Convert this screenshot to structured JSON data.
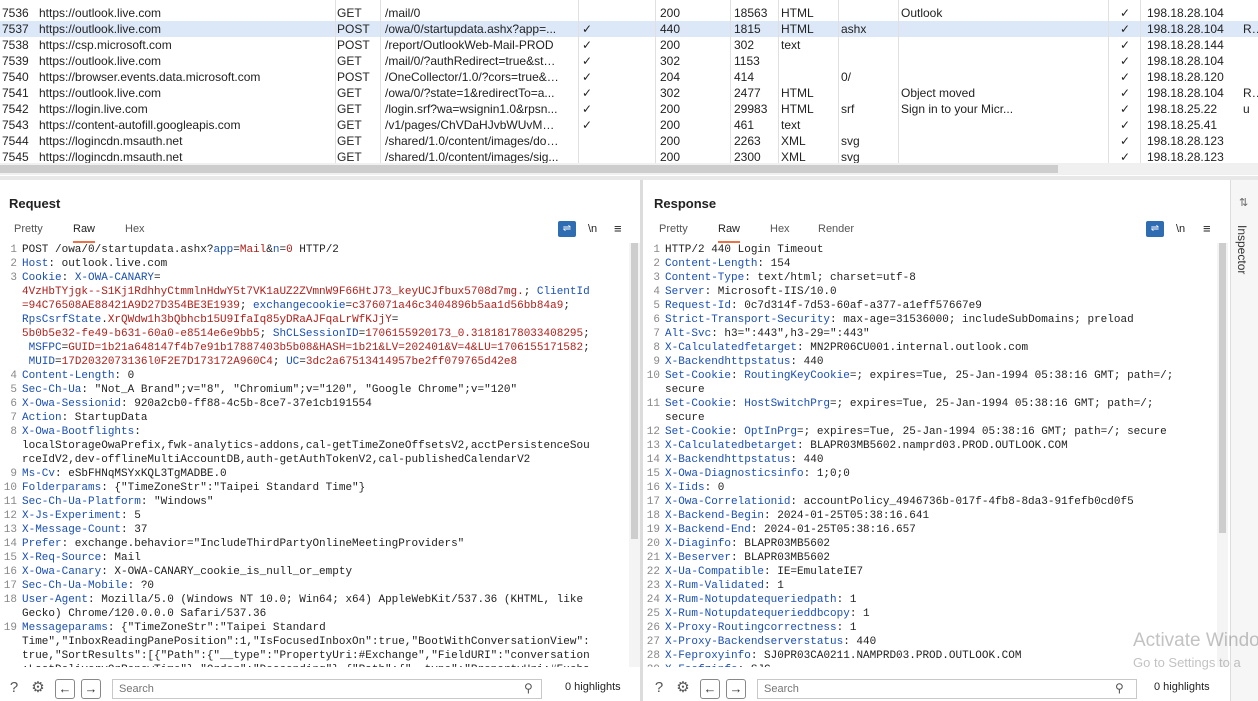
{
  "history": [
    {
      "id": "7536",
      "host": "https://outlook.live.com",
      "method": "GET",
      "url": "/mail/0",
      "params": "",
      "status": "200",
      "length": "18563",
      "mime": "HTML",
      "ext": "",
      "title": "Outlook",
      "tls": "✓",
      "ip": "198.18.28.104",
      "extra": ""
    },
    {
      "id": "7537",
      "host": "https://outlook.live.com",
      "method": "POST",
      "url": "/owa/0/startupdata.ashx?app=...",
      "params": "✓",
      "status": "440",
      "length": "1815",
      "mime": "HTML",
      "ext": "ashx",
      "title": "",
      "tls": "✓",
      "ip": "198.18.28.104",
      "extra": "Re",
      "selected": true
    },
    {
      "id": "7538",
      "host": "https://csp.microsoft.com",
      "method": "POST",
      "url": "/report/OutlookWeb-Mail-PROD",
      "params": "✓",
      "status": "200",
      "length": "302",
      "mime": "text",
      "ext": "",
      "title": "",
      "tls": "✓",
      "ip": "198.18.28.144",
      "extra": ""
    },
    {
      "id": "7539",
      "host": "https://outlook.live.com",
      "method": "GET",
      "url": "/mail/0/?authRedirect=true&sta...",
      "params": "✓",
      "status": "302",
      "length": "1153",
      "mime": "",
      "ext": "",
      "title": "",
      "tls": "✓",
      "ip": "198.18.28.104",
      "extra": ""
    },
    {
      "id": "7540",
      "host": "https://browser.events.data.microsoft.com",
      "method": "POST",
      "url": "/OneCollector/1.0/?cors=true&c...",
      "params": "✓",
      "status": "204",
      "length": "414",
      "mime": "",
      "ext": "0/",
      "title": "",
      "tls": "✓",
      "ip": "198.18.28.120",
      "extra": ""
    },
    {
      "id": "7541",
      "host": "https://outlook.live.com",
      "method": "GET",
      "url": "/owa/0/?state=1&redirectTo=a...",
      "params": "✓",
      "status": "302",
      "length": "2477",
      "mime": "HTML",
      "ext": "",
      "title": "Object moved",
      "tls": "✓",
      "ip": "198.18.28.104",
      "extra": "Re"
    },
    {
      "id": "7542",
      "host": "https://login.live.com",
      "method": "GET",
      "url": "/login.srf?wa=wsignin1.0&rpsn...",
      "params": "✓",
      "status": "200",
      "length": "29983",
      "mime": "HTML",
      "ext": "srf",
      "title": "Sign in to your Micr...",
      "tls": "✓",
      "ip": "198.18.25.22",
      "extra": "u"
    },
    {
      "id": "7543",
      "host": "https://content-autofill.googleapis.com",
      "method": "GET",
      "url": "/v1/pages/ChVDaHJvbWUvMTIw...",
      "params": "✓",
      "status": "200",
      "length": "461",
      "mime": "text",
      "ext": "",
      "title": "",
      "tls": "✓",
      "ip": "198.18.25.41",
      "extra": ""
    },
    {
      "id": "7544",
      "host": "https://logincdn.msauth.net",
      "method": "GET",
      "url": "/shared/1.0/content/images/doc...",
      "params": "",
      "status": "200",
      "length": "2263",
      "mime": "XML",
      "ext": "svg",
      "title": "",
      "tls": "✓",
      "ip": "198.18.28.123",
      "extra": ""
    },
    {
      "id": "7545",
      "host": "https://logincdn.msauth.net",
      "method": "GET",
      "url": "/shared/1.0/content/images/sig...",
      "params": "",
      "status": "200",
      "length": "2300",
      "mime": "XML",
      "ext": "svg",
      "title": "",
      "tls": "✓",
      "ip": "198.18.28.123",
      "extra": ""
    }
  ],
  "request": {
    "title": "Request",
    "tabs": [
      "Pretty",
      "Raw",
      "Hex"
    ],
    "active_tab": "Raw",
    "newline_label": "\\n",
    "lines": [
      {
        "n": "1",
        "parts": [
          [
            "v",
            "POST /owa/0/startupdata.ashx?"
          ],
          [
            "k",
            "app"
          ],
          [
            "v",
            "="
          ],
          [
            "r",
            "Mail"
          ],
          [
            "v",
            "&"
          ],
          [
            "k",
            "n"
          ],
          [
            "v",
            "="
          ],
          [
            "r",
            "0"
          ],
          [
            "v",
            " HTTP/2"
          ]
        ]
      },
      {
        "n": "2",
        "parts": [
          [
            "k",
            "Host"
          ],
          [
            "v",
            ": outlook.live.com"
          ]
        ]
      },
      {
        "n": "3",
        "parts": [
          [
            "k",
            "Cookie"
          ],
          [
            "v",
            ": "
          ],
          [
            "k",
            "X-OWA-CANARY"
          ],
          [
            "v",
            "="
          ]
        ]
      },
      {
        "n": "",
        "parts": [
          [
            "r",
            "4VzHbTYjgk--S1Kj1RdhhyCtmmlnHdwY5t7VK1aUZ2ZVmnW9F66HtJ73_keyUCJfbux5708d7mg."
          ],
          [
            "v",
            "; "
          ],
          [
            "k",
            "ClientId"
          ]
        ]
      },
      {
        "n": "",
        "parts": [
          [
            "r",
            "=94C76508AE88421A9D27D354BE3E1939"
          ],
          [
            "v",
            "; "
          ],
          [
            "k",
            "exchangecookie"
          ],
          [
            "v",
            "="
          ],
          [
            "r",
            "c376071a46c3404896b5aa1d56bb84a9"
          ],
          [
            "v",
            ";"
          ]
        ]
      },
      {
        "n": "",
        "parts": [
          [
            "k",
            "RpsCsrfState"
          ],
          [
            "v",
            "."
          ],
          [
            "r",
            "XrQWdw1h3bQbhcb15U9IfaIq85yDRaAJFqaLrWfKJjY"
          ],
          [
            "v",
            "="
          ]
        ]
      },
      {
        "n": "",
        "parts": [
          [
            "r",
            "5b0b5e32-fe49-b631-60a0-e8514e6e9bb5"
          ],
          [
            "v",
            "; "
          ],
          [
            "k",
            "ShCLSessionID"
          ],
          [
            "v",
            "="
          ],
          [
            "r",
            "1706155920173_0.31818178033408295"
          ],
          [
            "v",
            ";"
          ]
        ]
      },
      {
        "n": "",
        "parts": [
          [
            "k",
            " MSFPC"
          ],
          [
            "v",
            "="
          ],
          [
            "r",
            "GUID=1b21a648147f4b7e91b17887403b5b08&HASH=1b21&LV=202401&V=4&LU=1706155171582"
          ],
          [
            "v",
            ";"
          ]
        ]
      },
      {
        "n": "",
        "parts": [
          [
            "k",
            " MUID"
          ],
          [
            "v",
            "="
          ],
          [
            "r",
            "17D2032073136l0F2E7D173172A960C4"
          ],
          [
            "v",
            "; "
          ],
          [
            "k",
            "UC"
          ],
          [
            "v",
            "="
          ],
          [
            "r",
            "3dc2a67513414957be2ff079765d42e8"
          ]
        ]
      },
      {
        "n": "4",
        "parts": [
          [
            "k",
            "Content-Length"
          ],
          [
            "v",
            ": 0"
          ]
        ]
      },
      {
        "n": "5",
        "parts": [
          [
            "k",
            "Sec-Ch-Ua"
          ],
          [
            "v",
            ": \"Not_A Brand\";v=\"8\", \"Chromium\";v=\"120\", \"Google Chrome\";v=\"120\""
          ]
        ]
      },
      {
        "n": "6",
        "parts": [
          [
            "k",
            "X-Owa-Sessionid"
          ],
          [
            "v",
            ": 920a2cb0-ff88-4c5b-8ce7-37e1cb191554"
          ]
        ]
      },
      {
        "n": "7",
        "parts": [
          [
            "k",
            "Action"
          ],
          [
            "v",
            ": StartupData"
          ]
        ]
      },
      {
        "n": "8",
        "parts": [
          [
            "k",
            "X-Owa-Bootflights"
          ],
          [
            "v",
            ":"
          ]
        ]
      },
      {
        "n": "",
        "parts": [
          [
            "v",
            "localStorageOwaPrefix,fwk-analytics-addons,cal-getTimeZoneOffsetsV2,acctPersistenceSou"
          ]
        ]
      },
      {
        "n": "",
        "parts": [
          [
            "v",
            "rceIdV2,dev-offlineMultiAccountDB,auth-getAuthTokenV2,cal-publishedCalendarV2"
          ]
        ]
      },
      {
        "n": "9",
        "parts": [
          [
            "k",
            "Ms-Cv"
          ],
          [
            "v",
            ": eSbFHNqMSYxKQL3TgMADBE.0"
          ]
        ]
      },
      {
        "n": "10",
        "parts": [
          [
            "k",
            "Folderparams"
          ],
          [
            "v",
            ": {\"TimeZoneStr\":\"Taipei Standard Time\"}"
          ]
        ]
      },
      {
        "n": "11",
        "parts": [
          [
            "k",
            "Sec-Ch-Ua-Platform"
          ],
          [
            "v",
            ": \"Windows\""
          ]
        ]
      },
      {
        "n": "12",
        "parts": [
          [
            "k",
            "X-Js-Experiment"
          ],
          [
            "v",
            ": 5"
          ]
        ]
      },
      {
        "n": "13",
        "parts": [
          [
            "k",
            "X-Message-Count"
          ],
          [
            "v",
            ": 37"
          ]
        ]
      },
      {
        "n": "14",
        "parts": [
          [
            "k",
            "Prefer"
          ],
          [
            "v",
            ": exchange.behavior=\"IncludeThirdPartyOnlineMeetingProviders\""
          ]
        ]
      },
      {
        "n": "15",
        "parts": [
          [
            "k",
            "X-Req-Source"
          ],
          [
            "v",
            ": Mail"
          ]
        ]
      },
      {
        "n": "16",
        "parts": [
          [
            "k",
            "X-Owa-Canary"
          ],
          [
            "v",
            ": X-OWA-CANARY_cookie_is_null_or_empty"
          ]
        ]
      },
      {
        "n": "17",
        "parts": [
          [
            "k",
            "Sec-Ch-Ua-Mobile"
          ],
          [
            "v",
            ": ?0"
          ]
        ]
      },
      {
        "n": "18",
        "parts": [
          [
            "k",
            "User-Agent"
          ],
          [
            "v",
            ": Mozilla/5.0 (Windows NT 10.0; Win64; x64) AppleWebKit/537.36 (KHTML, like"
          ]
        ]
      },
      {
        "n": "",
        "parts": [
          [
            "v",
            "Gecko) Chrome/120.0.0.0 Safari/537.36"
          ]
        ]
      },
      {
        "n": "19",
        "parts": [
          [
            "k",
            "Messageparams"
          ],
          [
            "v",
            ": {\"TimeZoneStr\":\"Taipei Standard"
          ]
        ]
      },
      {
        "n": "",
        "parts": [
          [
            "v",
            "Time\",\"InboxReadingPanePosition\":1,\"IsFocusedInboxOn\":true,\"BootWithConversationView\":"
          ]
        ]
      },
      {
        "n": "",
        "parts": [
          [
            "v",
            "true,\"SortResults\":[{\"Path\":{\"__type\":\"PropertyUri:#Exchange\",\"FieldURI\":\"conversation"
          ]
        ]
      },
      {
        "n": "",
        "parts": [
          [
            "v",
            ":LastDeliveryOrRenewTime\"},\"Order\":\"Descending\"},{\"Path\":{\"__type\":\"PropertyUri:#Excha"
          ]
        ]
      }
    ],
    "search_placeholder": "Search",
    "highlights": "0 highlights"
  },
  "response": {
    "title": "Response",
    "tabs": [
      "Pretty",
      "Raw",
      "Hex",
      "Render"
    ],
    "active_tab": "Raw",
    "newline_label": "\\n",
    "lines": [
      {
        "n": "1",
        "parts": [
          [
            "v",
            "HTTP/2 440 Login Timeout"
          ]
        ]
      },
      {
        "n": "2",
        "parts": [
          [
            "k",
            "Content-Length"
          ],
          [
            "v",
            ": 154"
          ]
        ]
      },
      {
        "n": "3",
        "parts": [
          [
            "k",
            "Content-Type"
          ],
          [
            "v",
            ": text/html; charset=utf-8"
          ]
        ]
      },
      {
        "n": "4",
        "parts": [
          [
            "k",
            "Server"
          ],
          [
            "v",
            ": Microsoft-IIS/10.0"
          ]
        ]
      },
      {
        "n": "5",
        "parts": [
          [
            "k",
            "Request-Id"
          ],
          [
            "v",
            ": 0c7d314f-7d53-60af-a377-a1eff57667e9"
          ]
        ]
      },
      {
        "n": "6",
        "parts": [
          [
            "k",
            "Strict-Transport-Security"
          ],
          [
            "v",
            ": max-age=31536000; includeSubDomains; preload"
          ]
        ]
      },
      {
        "n": "7",
        "parts": [
          [
            "k",
            "Alt-Svc"
          ],
          [
            "v",
            ": h3=\":443\",h3-29=\":443\""
          ]
        ]
      },
      {
        "n": "8",
        "parts": [
          [
            "k",
            "X-Calculatedfetarget"
          ],
          [
            "v",
            ": MN2PR06CU001.internal.outlook.com"
          ]
        ]
      },
      {
        "n": "9",
        "parts": [
          [
            "k",
            "X-Backendhttpstatus"
          ],
          [
            "v",
            ": 440"
          ]
        ]
      },
      {
        "n": "10",
        "parts": [
          [
            "k",
            "Set-Cookie"
          ],
          [
            "v",
            ": "
          ],
          [
            "k",
            "RoutingKeyCookie"
          ],
          [
            "v",
            "=; expires=Tue, 25-Jan-1994 05:38:16 GMT; path=/;"
          ]
        ]
      },
      {
        "n": "",
        "parts": [
          [
            "v",
            "secure"
          ]
        ]
      },
      {
        "n": "11",
        "parts": [
          [
            "k",
            "Set-Cookie"
          ],
          [
            "v",
            ": "
          ],
          [
            "k",
            "HostSwitchPrg"
          ],
          [
            "v",
            "=; expires=Tue, 25-Jan-1994 05:38:16 GMT; path=/;"
          ]
        ]
      },
      {
        "n": "",
        "parts": [
          [
            "v",
            "secure"
          ]
        ]
      },
      {
        "n": "12",
        "parts": [
          [
            "k",
            "Set-Cookie"
          ],
          [
            "v",
            ": "
          ],
          [
            "k",
            "OptInPrg"
          ],
          [
            "v",
            "=; expires=Tue, 25-Jan-1994 05:38:16 GMT; path=/; secure"
          ]
        ]
      },
      {
        "n": "13",
        "parts": [
          [
            "k",
            "X-Calculatedbetarget"
          ],
          [
            "v",
            ": BLAPR03MB5602.namprd03.PROD.OUTLOOK.COM"
          ]
        ]
      },
      {
        "n": "14",
        "parts": [
          [
            "k",
            "X-Backendhttpstatus"
          ],
          [
            "v",
            ": 440"
          ]
        ]
      },
      {
        "n": "15",
        "parts": [
          [
            "k",
            "X-Owa-Diagnosticsinfo"
          ],
          [
            "v",
            ": 1;0;0"
          ]
        ]
      },
      {
        "n": "16",
        "parts": [
          [
            "k",
            "X-Iids"
          ],
          [
            "v",
            ": 0"
          ]
        ]
      },
      {
        "n": "17",
        "parts": [
          [
            "k",
            "X-Owa-Correlationid"
          ],
          [
            "v",
            ": accountPolicy_4946736b-017f-4fb8-8da3-91fefb0cd0f5"
          ]
        ]
      },
      {
        "n": "18",
        "parts": [
          [
            "k",
            "X-Backend-Begin"
          ],
          [
            "v",
            ": 2024-01-25T05:38:16.641"
          ]
        ]
      },
      {
        "n": "19",
        "parts": [
          [
            "k",
            "X-Backend-End"
          ],
          [
            "v",
            ": 2024-01-25T05:38:16.657"
          ]
        ]
      },
      {
        "n": "20",
        "parts": [
          [
            "k",
            "X-Diaginfo"
          ],
          [
            "v",
            ": BLAPR03MB5602"
          ]
        ]
      },
      {
        "n": "21",
        "parts": [
          [
            "k",
            "X-Beserver"
          ],
          [
            "v",
            ": BLAPR03MB5602"
          ]
        ]
      },
      {
        "n": "22",
        "parts": [
          [
            "k",
            "X-Ua-Compatible"
          ],
          [
            "v",
            ": IE=EmulateIE7"
          ]
        ]
      },
      {
        "n": "23",
        "parts": [
          [
            "k",
            "X-Rum-Validated"
          ],
          [
            "v",
            ": 1"
          ]
        ]
      },
      {
        "n": "24",
        "parts": [
          [
            "k",
            "X-Rum-Notupdatequeriedpath"
          ],
          [
            "v",
            ": 1"
          ]
        ]
      },
      {
        "n": "25",
        "parts": [
          [
            "k",
            "X-Rum-Notupdatequerieddbcopy"
          ],
          [
            "v",
            ": 1"
          ]
        ]
      },
      {
        "n": "26",
        "parts": [
          [
            "k",
            "X-Proxy-Routingcorrectness"
          ],
          [
            "v",
            ": 1"
          ]
        ]
      },
      {
        "n": "27",
        "parts": [
          [
            "k",
            "X-Proxy-Backendserverstatus"
          ],
          [
            "v",
            ": 440"
          ]
        ]
      },
      {
        "n": "28",
        "parts": [
          [
            "k",
            "X-Feproxyinfo"
          ],
          [
            "v",
            ": SJ0PR03CA0211.NAMPRD03.PROD.OUTLOOK.COM"
          ]
        ]
      },
      {
        "n": "29",
        "parts": [
          [
            "k",
            "X-Feefzinfo"
          ],
          [
            "v",
            ": SJC"
          ]
        ]
      }
    ],
    "search_placeholder": "Search",
    "highlights": "0 highlights"
  },
  "inspector": {
    "label": "Inspector"
  },
  "watermark": {
    "line1": "Activate Windo",
    "line2": "Go to Settings to a"
  }
}
